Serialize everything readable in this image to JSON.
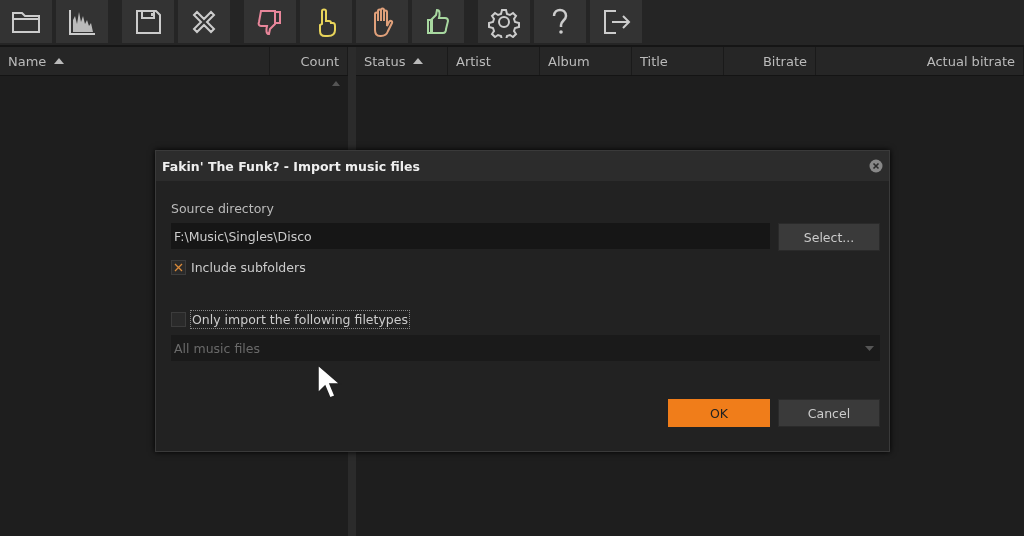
{
  "left_table": {
    "columns": [
      {
        "label": "Name",
        "sorted": true
      },
      {
        "label": "Count",
        "sorted": false
      }
    ]
  },
  "right_table": {
    "columns": [
      {
        "label": "Status",
        "sorted": true
      },
      {
        "label": "Artist",
        "sorted": false
      },
      {
        "label": "Album",
        "sorted": false
      },
      {
        "label": "Title",
        "sorted": false
      },
      {
        "label": "Bitrate",
        "sorted": false
      },
      {
        "label": "Actual bitrate",
        "sorted": false
      }
    ]
  },
  "dialog": {
    "title": "Fakin' The Funk? - Import music files",
    "source_label": "Source directory",
    "source_path": "F:\\Music\\Singles\\Disco",
    "select_button": "Select...",
    "include_subfolders": {
      "label": "Include subfolders",
      "checked": true
    },
    "only_filetypes": {
      "label": "Only import the following filetypes",
      "checked": false
    },
    "filetype_dropdown": {
      "value": "All music files",
      "disabled": true
    },
    "ok_button": "OK",
    "cancel_button": "Cancel"
  }
}
